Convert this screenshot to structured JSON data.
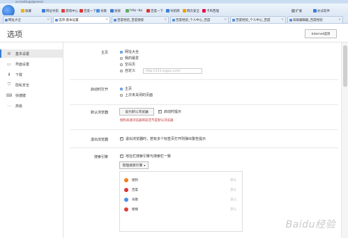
{
  "window": {
    "title": "se:/settings/general"
  },
  "toolbar": {
    "bookmarks": [
      {
        "label": "收藏",
        "color": "#f2b300"
      },
      {
        "label": "网址导航",
        "color": "#3a7dd8"
      },
      {
        "label": "游戏中心",
        "color": "#e0403a"
      },
      {
        "label": "百度一下",
        "color": "#d33"
      },
      {
        "label": "谷歌",
        "color": "#4a90e2"
      },
      {
        "label": "链接",
        "color": "#3a7dd8"
      },
      {
        "label": "http--bp",
        "color": "#6a6"
      },
      {
        "label": "百度一下",
        "color": "#d33"
      },
      {
        "label": "导航网",
        "color": "#3a7dd8"
      },
      {
        "label": "网页安全",
        "color": "#f2a000"
      },
      {
        "label": "卡布西理",
        "color": "#e04"
      },
      {
        "label": "扩展",
        "color": "#999"
      },
      {
        "label": "办法软件",
        "color": "#3a7dd8"
      }
    ]
  },
  "tabs": [
    {
      "label": "网址大全",
      "active": false
    },
    {
      "label": "选项-基本设置",
      "active": true
    },
    {
      "label": "百度经验_百度搜索",
      "active": false
    },
    {
      "label": "百度经验_个人中心_百度",
      "active": false
    },
    {
      "label": "百度经验_个人中心_百度",
      "active": false
    },
    {
      "label": "高级编辑器_百度经验",
      "active": false
    }
  ],
  "header": {
    "title": "选项",
    "ie_button": "Internet选项"
  },
  "sidebar": {
    "items": [
      {
        "label": "基本设置",
        "icon": "gear-icon",
        "glyph": "⚙",
        "active": true
      },
      {
        "label": "界面设置",
        "icon": "window-icon",
        "glyph": "▭",
        "active": false
      },
      {
        "label": "下载",
        "icon": "download-icon",
        "glyph": "⬇",
        "active": false
      },
      {
        "label": "隐私安全",
        "icon": "shield-icon",
        "glyph": "⛉",
        "active": false
      },
      {
        "label": "快捷键",
        "icon": "keyboard-icon",
        "glyph": "⌨",
        "active": false
      },
      {
        "label": "高级",
        "icon": "more-icon",
        "glyph": "⋯",
        "active": false
      }
    ]
  },
  "homepage": {
    "label": "主页",
    "options": [
      {
        "label": "网址大全",
        "selected": true
      },
      {
        "label": "我的最爱",
        "selected": false
      },
      {
        "label": "空白页",
        "selected": false
      },
      {
        "label": "自定义",
        "selected": false
      }
    ],
    "custom_url": "http://123.sogou.com/"
  },
  "startup": {
    "label": "启动时打开",
    "options": [
      {
        "label": "主页",
        "selected": true
      },
      {
        "label": "上次未关闭的页面",
        "selected": false
      }
    ]
  },
  "default_browser": {
    "label": "默认浏览器",
    "set_button": "设为默认浏览器",
    "startup_check": "启动时提示",
    "startup_check_checked": true,
    "warning": "搜狗高速浏览器目前还不是默认浏览器"
  },
  "exit_browser": {
    "label": "退出浏览器",
    "option": "退出浏览器时，若有多个标签页打开则弹出警告提示",
    "checked": true
  },
  "search_engine": {
    "label": "搜索引擎",
    "option": "地址栏搜索引擎与搜索栏一致",
    "checked": true,
    "manage_button": "管理搜索引擎",
    "engines": [
      {
        "label": "搜狗",
        "default": "默认",
        "color": "#f27d1a"
      },
      {
        "label": "百度",
        "default": "默认",
        "color": "#d33"
      },
      {
        "label": "谷歌",
        "default": "默认",
        "color": "#4a90e2"
      },
      {
        "label": "搜搜",
        "default": "默认",
        "color": "#e0403a"
      }
    ]
  },
  "watermark": "Baidu经验"
}
